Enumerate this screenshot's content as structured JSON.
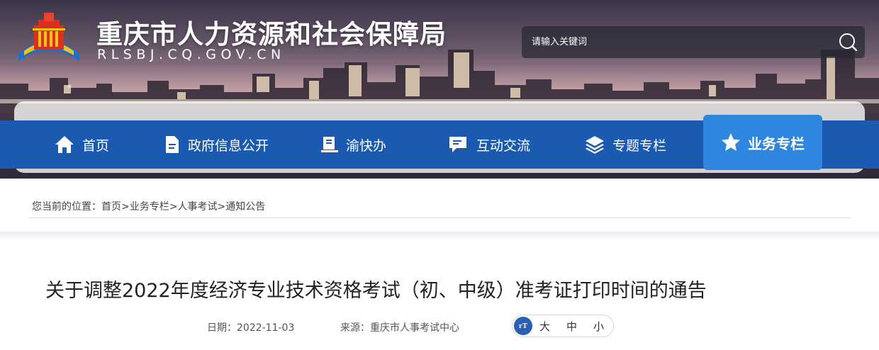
{
  "header": {
    "site_title": "重庆市人力资源和社会保障局",
    "site_domain": "RLSBJ.CQ.GOV.CN",
    "logo_icon": "government-logo-icon",
    "search": {
      "placeholder": "请输入关键词",
      "icon": "search-icon"
    }
  },
  "nav": {
    "items": [
      {
        "label": "首页",
        "icon": "home-icon"
      },
      {
        "label": "政府信息公开",
        "icon": "document-icon"
      },
      {
        "label": "渝快办",
        "icon": "book-icon"
      },
      {
        "label": "互动交流",
        "icon": "chat-icon"
      },
      {
        "label": "专题专栏",
        "icon": "layers-icon"
      },
      {
        "label": "业务专栏",
        "icon": "star-icon",
        "active": true
      }
    ]
  },
  "breadcrumb": {
    "prefix": "您当前的位置：",
    "items": [
      "首页",
      "业务专栏",
      "人事考试",
      "通知公告"
    ],
    "separator": ">"
  },
  "article": {
    "title": "关于调整2022年度经济专业技术资格考试（初、中级）准考证打印时间的通告",
    "date": "日期：2022-11-03",
    "source": "来源：重庆市人事考试中心",
    "font_size": {
      "icon_label": "rT",
      "large": "大",
      "medium": "中",
      "small": "小"
    }
  },
  "colors": {
    "nav_bg": "#1a5ab0",
    "nav_active": "#2f86de",
    "text": "#222222"
  }
}
